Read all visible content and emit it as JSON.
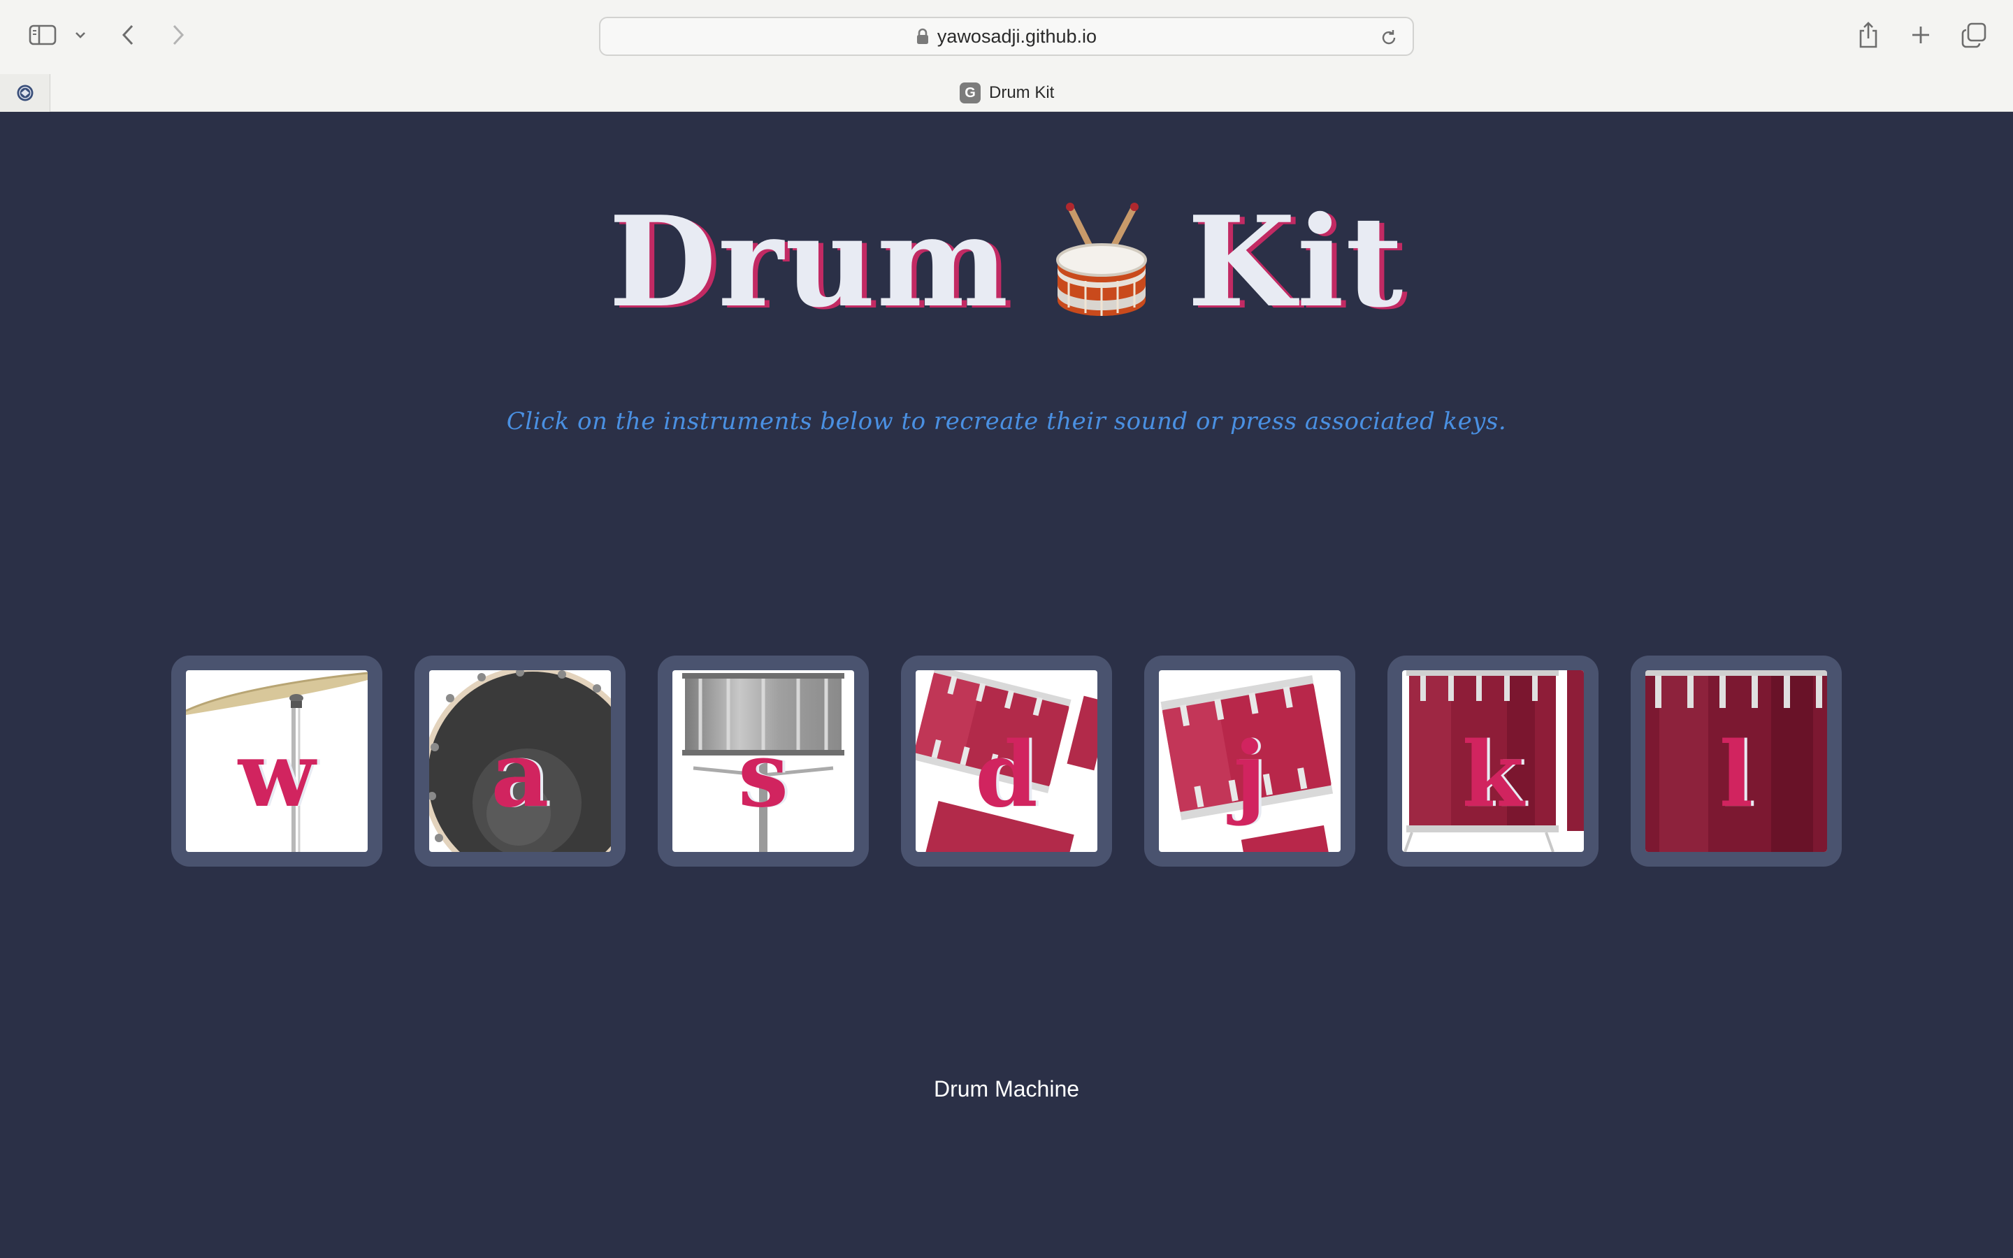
{
  "browser": {
    "url": "yawosadji.github.io",
    "tab_title": "Drum Kit",
    "favicon_letter": "G"
  },
  "page": {
    "title_left": "Drum",
    "title_right": "Kit",
    "subtitle": "Click on the instruments below to recreate their sound or press associated keys.",
    "footer": "Drum Machine",
    "colors": {
      "background": "#2b3047",
      "title": "#e8ebf3",
      "title_shadow": "#c22a63",
      "subtitle": "#4a90e2",
      "key_letter": "#d1245f",
      "pad_frame": "#4a536f"
    }
  },
  "drums": [
    {
      "key": "w",
      "instrument": "crash-cymbal"
    },
    {
      "key": "a",
      "instrument": "kick-bass"
    },
    {
      "key": "s",
      "instrument": "snare"
    },
    {
      "key": "d",
      "instrument": "tom-1"
    },
    {
      "key": "j",
      "instrument": "tom-2"
    },
    {
      "key": "k",
      "instrument": "tom-3"
    },
    {
      "key": "l",
      "instrument": "tom-4"
    }
  ]
}
